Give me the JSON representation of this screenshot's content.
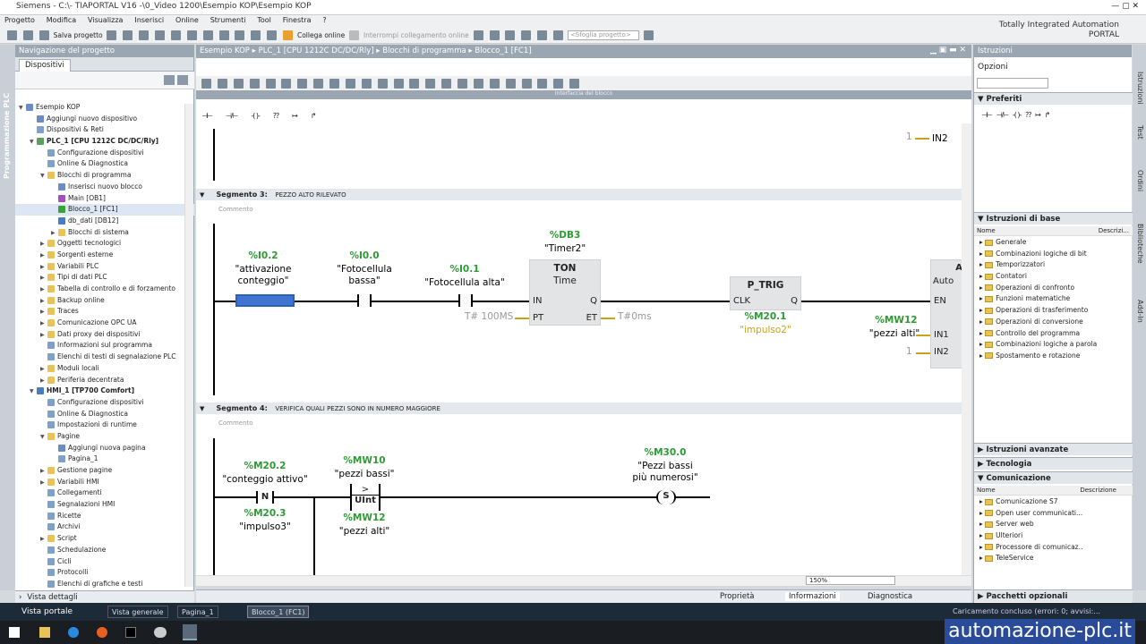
{
  "window": {
    "title": "Siemens  -  C:\\- TIAPORTAL V16 -\\0_Video 1200\\Esempio KOP\\Esempio KOP"
  },
  "menu": [
    "Progetto",
    "Modifica",
    "Visualizza",
    "Inserisci",
    "Online",
    "Strumenti",
    "Tool",
    "Finestra",
    "?"
  ],
  "toolbar": {
    "save": "Salva progetto",
    "connect": "Collega online",
    "disconnect": "Interrompi collegamento online",
    "search": "<Sfoglia progetto>"
  },
  "brand": {
    "line1": "Totally Integrated Automation",
    "line2": "PORTAL"
  },
  "leftstrip": "Programmazione PLC",
  "nav": {
    "title": "Navigazione del progetto",
    "tab": "Dispositivi",
    "items": [
      {
        "label": "Esempio KOP",
        "lvl": 0,
        "arrow": "▼",
        "color": "#6b8cc4"
      },
      {
        "label": "Aggiungi nuovo dispositivo",
        "lvl": 1,
        "arrow": "",
        "color": "#6b8cc4"
      },
      {
        "label": "Dispositivi & Reti",
        "lvl": 1,
        "arrow": "",
        "color": "#7fa0c8"
      },
      {
        "label": "PLC_1 [CPU 1212C DC/DC/Rly]",
        "lvl": 1,
        "arrow": "▼",
        "color": "#5aa05a",
        "bold": true
      },
      {
        "label": "Configurazione dispositivi",
        "lvl": 2,
        "arrow": "",
        "color": "#7fa0c8"
      },
      {
        "label": "Online & Diagnostica",
        "lvl": 2,
        "arrow": "",
        "color": "#7fa0c8"
      },
      {
        "label": "Blocchi di programma",
        "lvl": 2,
        "arrow": "▼",
        "color": "#e8c35a"
      },
      {
        "label": "Inserisci nuovo blocco",
        "lvl": 3,
        "arrow": "",
        "color": "#6b8cc4"
      },
      {
        "label": "Main [OB1]",
        "lvl": 3,
        "arrow": "",
        "color": "#a050c0"
      },
      {
        "label": "Blocco_1 [FC1]",
        "lvl": 3,
        "arrow": "",
        "color": "#3aa03a",
        "sel": true
      },
      {
        "label": "db_dati [DB12]",
        "lvl": 3,
        "arrow": "",
        "color": "#4a7cc4"
      },
      {
        "label": "Blocchi di sistema",
        "lvl": 3,
        "arrow": "▶",
        "color": "#e8c35a"
      },
      {
        "label": "Oggetti tecnologici",
        "lvl": 2,
        "arrow": "▶",
        "color": "#e8c35a"
      },
      {
        "label": "Sorgenti esterne",
        "lvl": 2,
        "arrow": "▶",
        "color": "#e8c35a"
      },
      {
        "label": "Variabili PLC",
        "lvl": 2,
        "arrow": "▶",
        "color": "#e8c35a"
      },
      {
        "label": "Tipi di dati PLC",
        "lvl": 2,
        "arrow": "▶",
        "color": "#e8c35a"
      },
      {
        "label": "Tabella di controllo e di forzamento",
        "lvl": 2,
        "arrow": "▶",
        "color": "#e8c35a"
      },
      {
        "label": "Backup online",
        "lvl": 2,
        "arrow": "▶",
        "color": "#e8c35a"
      },
      {
        "label": "Traces",
        "lvl": 2,
        "arrow": "▶",
        "color": "#e8c35a"
      },
      {
        "label": "Comunicazione OPC UA",
        "lvl": 2,
        "arrow": "▶",
        "color": "#e8c35a"
      },
      {
        "label": "Dati proxy dei dispositivi",
        "lvl": 2,
        "arrow": "▶",
        "color": "#e8c35a"
      },
      {
        "label": "Informazioni sul programma",
        "lvl": 2,
        "arrow": "",
        "color": "#7fa0c8"
      },
      {
        "label": "Elenchi di testi di segnalazione PLC",
        "lvl": 2,
        "arrow": "",
        "color": "#7fa0c8"
      },
      {
        "label": "Moduli locali",
        "lvl": 2,
        "arrow": "▶",
        "color": "#e8c35a"
      },
      {
        "label": "Periferia decentrata",
        "lvl": 2,
        "arrow": "▶",
        "color": "#e8c35a"
      },
      {
        "label": "HMI_1 [TP700 Comfort]",
        "lvl": 1,
        "arrow": "▼",
        "color": "#4a7cc4",
        "bold": true
      },
      {
        "label": "Configurazione dispositivi",
        "lvl": 2,
        "arrow": "",
        "color": "#7fa0c8"
      },
      {
        "label": "Online & Diagnostica",
        "lvl": 2,
        "arrow": "",
        "color": "#7fa0c8"
      },
      {
        "label": "Impostazioni di runtime",
        "lvl": 2,
        "arrow": "",
        "color": "#7fa0c8"
      },
      {
        "label": "Pagine",
        "lvl": 2,
        "arrow": "▼",
        "color": "#e8c35a"
      },
      {
        "label": "Aggiungi nuova pagina",
        "lvl": 3,
        "arrow": "",
        "color": "#6b8cc4"
      },
      {
        "label": "Pagina_1",
        "lvl": 3,
        "arrow": "",
        "color": "#7fa0c8"
      },
      {
        "label": "Gestione pagine",
        "lvl": 2,
        "arrow": "▶",
        "color": "#e8c35a"
      },
      {
        "label": "Variabili HMI",
        "lvl": 2,
        "arrow": "▶",
        "color": "#e8c35a"
      },
      {
        "label": "Collegamenti",
        "lvl": 2,
        "arrow": "",
        "color": "#7fa0c8"
      },
      {
        "label": "Segnalazioni HMI",
        "lvl": 2,
        "arrow": "",
        "color": "#7fa0c8"
      },
      {
        "label": "Ricette",
        "lvl": 2,
        "arrow": "",
        "color": "#7fa0c8"
      },
      {
        "label": "Archivi",
        "lvl": 2,
        "arrow": "",
        "color": "#7fa0c8"
      },
      {
        "label": "Script",
        "lvl": 2,
        "arrow": "▶",
        "color": "#e8c35a"
      },
      {
        "label": "Schedulazione",
        "lvl": 2,
        "arrow": "",
        "color": "#7fa0c8"
      },
      {
        "label": "Cicli",
        "lvl": 2,
        "arrow": "",
        "color": "#7fa0c8"
      },
      {
        "label": "Protocolli",
        "lvl": 2,
        "arrow": "",
        "color": "#7fa0c8"
      },
      {
        "label": "Elenchi di grafiche e testi",
        "lvl": 2,
        "arrow": "",
        "color": "#7fa0c8"
      }
    ],
    "details": "Vista dettagli"
  },
  "breadcrumb": [
    "Esempio KOP",
    "PLC_1 [CPU 1212C DC/DC/Rly]",
    "Blocchi di programma",
    "Blocco_1 [FC1]"
  ],
  "interface_label": "Interfaccia del blocco",
  "favorites": [
    "⊣⊢",
    "⊣/⊢",
    "-( )-",
    "??",
    "↦",
    "↱"
  ],
  "seg2": {
    "one": "1",
    "in2": "IN2"
  },
  "seg3": {
    "title": "Segmento 3:",
    "desc": "PEZZO ALTO RILEVATO",
    "comment": "Commento",
    "c1_addr": "%I0.2",
    "c1_name": "\"attivazione",
    "c1_name2": "conteggio\"",
    "c2_addr": "%I0.0",
    "c2_name": "\"Fotocellula",
    "c2_name2": "bassa\"",
    "c3_addr": "%I0.1",
    "c3_name": "\"Fotocellula alta\"",
    "ton_db": "%DB3",
    "ton_name": "\"Timer2\"",
    "ton_t1": "TON",
    "ton_t2": "Time",
    "ton_in": "IN",
    "ton_q": "Q",
    "ton_pt": "PT",
    "ton_et": "ET",
    "pt_val": "T# 100MS",
    "et_val": "T#0ms",
    "ptrig": "P_TRIG",
    "ptrig_clk": "CLK",
    "ptrig_q": "Q",
    "ptrig_addr": "%M20.1",
    "ptrig_name": "\"impulso2\"",
    "add_t1": "A",
    "add_t2": "Auto",
    "add_en": "EN",
    "add_in1": "IN1",
    "add_in2": "IN2",
    "mw_addr": "%MW12",
    "mw_name": "\"pezzi alti\"",
    "one": "1"
  },
  "seg4": {
    "title": "Segmento 4:",
    "desc": "VERIFICA QUALI PEZZI SONO IN NUMERO MAGGIORE",
    "comment": "Commento",
    "n_addr": "%M20.2",
    "n_name": "\"conteggio attivo\"",
    "n_sym": "N",
    "n2_addr": "%M20.3",
    "n2_name": "\"impulso3\"",
    "cmp_addr": "%MW10",
    "cmp_name": "\"pezzi bassi\"",
    "cmp_sym": ">",
    "cmp_type": "UInt",
    "cmp2_addr": "%MW12",
    "cmp2_name": "\"pezzi alti\"",
    "coil_addr": "%M30.0",
    "coil_name": "\"Pezzi bassi",
    "coil_name2": "più numerosi\"",
    "coil_sym": "S"
  },
  "zoom": "150%",
  "bottomtabs": {
    "props": "Proprietà",
    "info": "Informazioni",
    "diag": "Diagnostica"
  },
  "right": {
    "title": "Istruzioni",
    "options": "Opzioni",
    "favorites": "Preferiti",
    "base": "Istruzioni di base",
    "col_name": "Nome",
    "col_desc": "Descrizi...",
    "base_items": [
      "Generale",
      "Combinazioni logiche di bit",
      "Temporizzatori",
      "Contatori",
      "Operazioni di confronto",
      "Funzioni matematiche",
      "Operazioni di trasferimento",
      "Operazioni di conversione",
      "Controllo del programma",
      "Combinazioni logiche a parola",
      "Spostamento e rotazione"
    ],
    "advanced": "Istruzioni avanzate",
    "tech": "Tecnologia",
    "comm": "Comunicazione",
    "comm_desc": "Descrizione",
    "comm_items": [
      "Comunicazione S7",
      "Open user communicati...",
      "Server web",
      "Ulteriori",
      "Processore di comunicaz..",
      "TeleService"
    ],
    "packages": "Pacchetti opzionali"
  },
  "rightstrip": [
    "Istruzioni",
    "Test",
    "Ordini",
    "Biblioteche",
    "Add-In"
  ],
  "taskbar": {
    "portal": "Vista portale",
    "t1": "Vista generale",
    "t2": "Pagina_1",
    "t3": "Blocco_1 (FC1)",
    "status": "Caricamento concluso (errori: 0; avvisi:..."
  },
  "watermark": "automazione-plc.it"
}
